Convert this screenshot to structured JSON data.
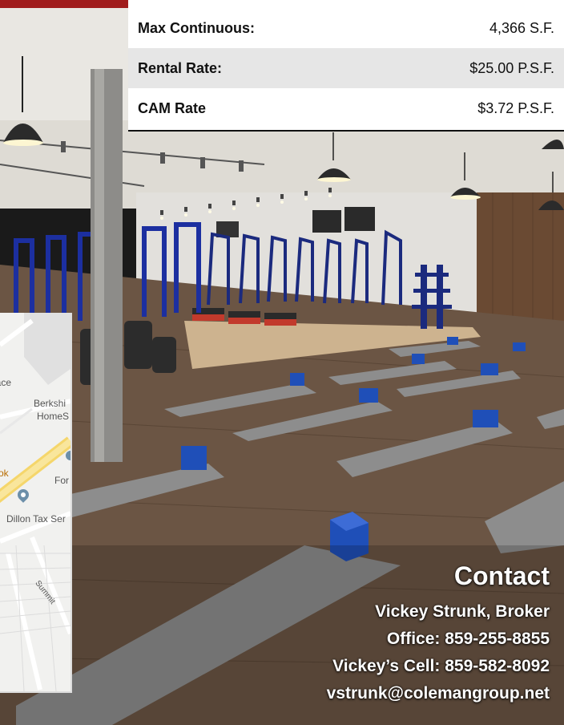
{
  "details": {
    "rows": [
      {
        "label": "Max Continuous:",
        "value": "4,366 S.F."
      },
      {
        "label": "Rental Rate:",
        "value": "$25.00 P.S.F."
      },
      {
        "label": "CAM Rate",
        "value": "$3.72 P.S.F."
      }
    ]
  },
  "map": {
    "labels": {
      "place": "lace",
      "berk": "Berkshi",
      "home": "HomeS",
      "ok": "ok",
      "for": "For",
      "dillon": "Dillon Tax Ser",
      "summit": "Summit"
    }
  },
  "contact": {
    "title": "Contact",
    "broker": "Vickey Strunk, Broker",
    "office": "Office: 859-255-8855",
    "cell": "Vickey’s Cell: 859-582-8092",
    "email": "vstrunk@colemangroup.net"
  },
  "colors": {
    "accent_red": "#a01c1c",
    "table_alt_row": "#e6e6e6",
    "floor_wood": "#6b5544",
    "mat_gray": "#8d8d8d",
    "yoga_block_blue": "#1f4fb8",
    "rack_blue": "#1c2fa0"
  }
}
